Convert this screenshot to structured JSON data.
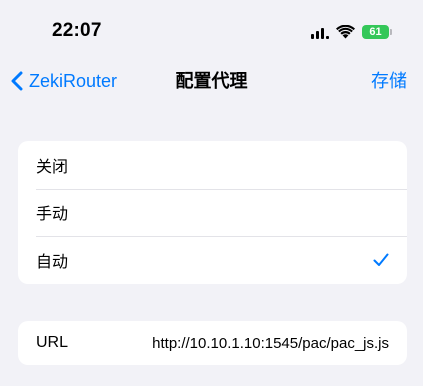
{
  "status_bar": {
    "time": "22:07",
    "battery_level": "61",
    "battery_color": "#34c759",
    "icons": [
      "signal-icon",
      "wifi-icon",
      "battery-icon"
    ]
  },
  "nav": {
    "back_label": "ZekiRouter",
    "title": "配置代理",
    "save_label": "存储",
    "accent_color": "#007aff"
  },
  "proxy_options": [
    {
      "label": "关闭",
      "selected": false
    },
    {
      "label": "手动",
      "selected": false
    },
    {
      "label": "自动",
      "selected": true
    }
  ],
  "url_field": {
    "label": "URL",
    "value": "http://10.10.1.10:1545/pac/pac_js.js"
  }
}
